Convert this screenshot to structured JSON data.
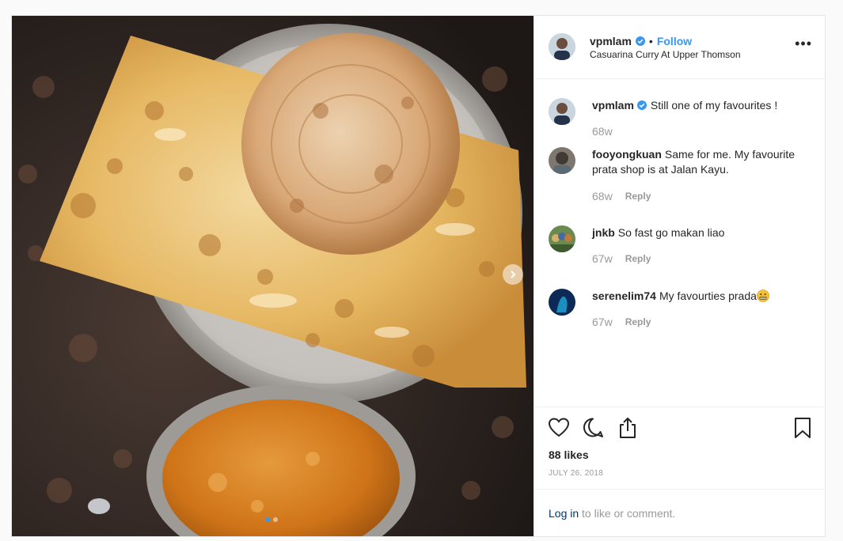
{
  "post": {
    "author": "vpmlam",
    "follow_label": "Follow",
    "separator": "•",
    "location": "Casuarina Curry At Upper Thomson",
    "more_label": "•••",
    "likes": "88 likes",
    "date": "JULY 26, 2018",
    "carousel": {
      "total": 2,
      "current": 1
    }
  },
  "comments": [
    {
      "user": "vpmlam",
      "text": "Still one of my favourites !",
      "time": "68w",
      "reply": "",
      "verified": true
    },
    {
      "user": "fooyongkuan",
      "text": "Same for me. My favourite prata shop is at Jalan Kayu.",
      "time": "68w",
      "reply": "Reply"
    },
    {
      "user": "jnkb",
      "text": "So fast go makan liao",
      "time": "67w",
      "reply": "Reply"
    },
    {
      "user": "serenelim74",
      "text": "My favourties prada",
      "time": "67w",
      "reply": "Reply",
      "emoji": "grimacing-face"
    }
  ],
  "login": {
    "link": "Log in",
    "rest": " to like or comment."
  },
  "icons": {
    "verified": "verified-badge-icon",
    "like": "heart-icon",
    "comment": "comment-bubble-icon",
    "share": "share-icon",
    "save": "bookmark-icon",
    "next": "chevron-right-icon"
  },
  "colors": {
    "accent": "#3897f0",
    "link": "#003569",
    "muted": "#999999"
  }
}
